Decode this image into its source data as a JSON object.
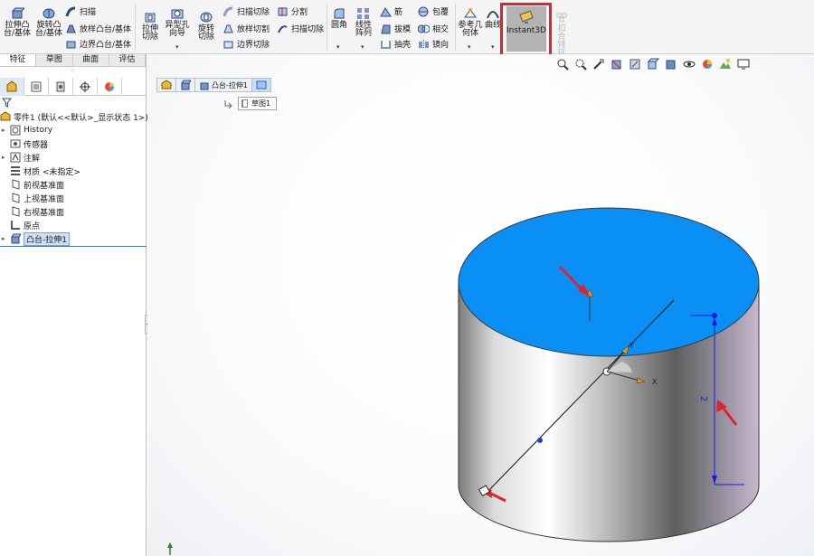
{
  "ribbon": {
    "extrude_boss": "拉伸凸台/基体",
    "revolve_boss": "旋转凸台/基体",
    "sweep": "扫描",
    "loft_boss": "放样凸台/基体",
    "boundary_boss": "边界凸台/基体",
    "extrude_cut": "拉伸切除",
    "hole_wizard": "异型孔向导",
    "revolve_cut": "旋转切除",
    "swept_cut": "扫描切除",
    "lofted_cut": "放样切割",
    "boundary_cut": "边界切除",
    "split": "分割",
    "swept_cut2": "扫描切除",
    "fillet": "圆角",
    "linear_pattern": "线性阵列",
    "rib": "筋",
    "draft": "拔模",
    "shell": "抽壳",
    "wrap": "包覆",
    "intersect": "相交",
    "mirror": "镜向",
    "reference_geometry": "参考几何体",
    "curves": "曲线",
    "instant3d": "Instant3D",
    "disabled_feature": "扣合特征"
  },
  "command_manager_tabs": [
    "特征",
    "草图",
    "曲面",
    "评估"
  ],
  "tree": {
    "part": "零件1 (默认<<默认>_显示状态 1>)",
    "history": "History",
    "sensors": "传感器",
    "annotations": "注解",
    "material": "材质 <未指定>",
    "front_plane": "前视基准面",
    "top_plane": "上视基准面",
    "right_plane": "右视基准面",
    "origin": "原点",
    "boss_extrude": "凸台-拉伸1"
  },
  "breadcrumb": {
    "feature": "凸台-拉伸1",
    "sketch": "草图1"
  },
  "viewport": {
    "axis_x": "X",
    "axis_y": "Y",
    "dimension": "2",
    "face_color": "#0a90f5",
    "highlight_color": "#e0232b"
  }
}
